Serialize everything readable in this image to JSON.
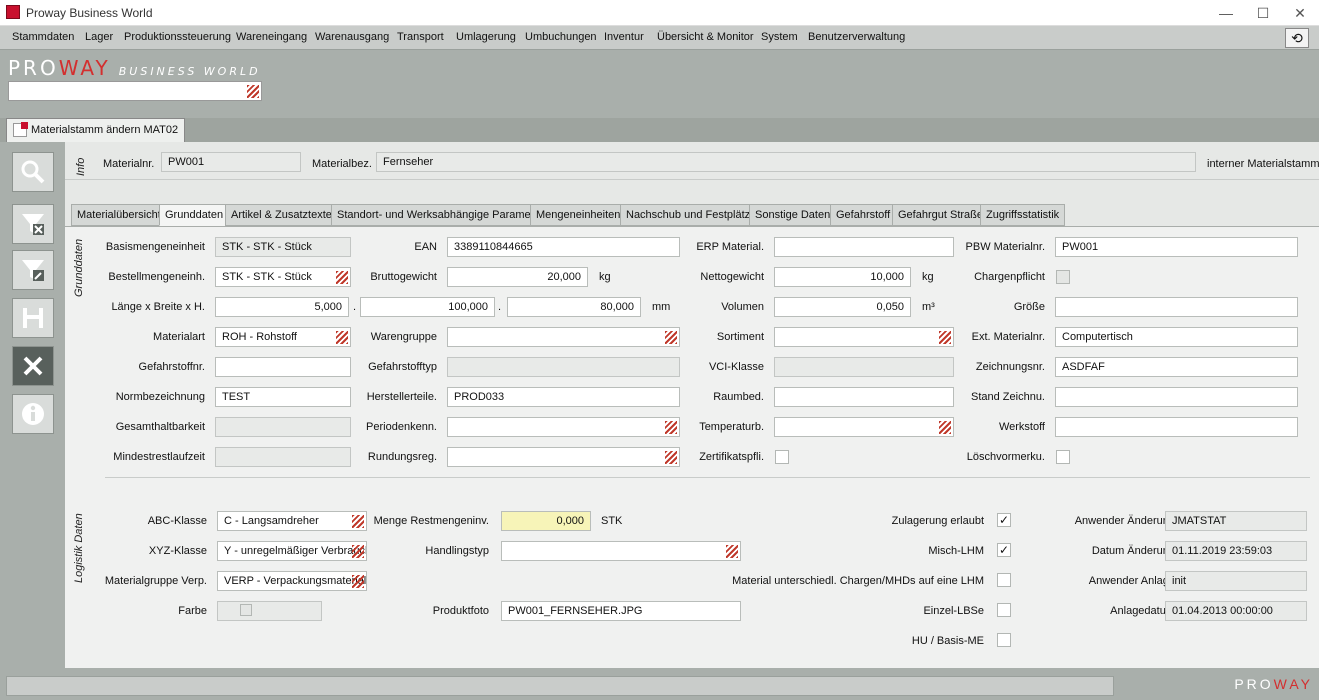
{
  "window": {
    "title": "Proway Business World",
    "minimize": "—",
    "maximize": "☐",
    "close": "✕"
  },
  "menu": [
    "Stammdaten",
    "Lager",
    "Produktionssteuerung",
    "Wareneingang",
    "Warenausgang",
    "Transport",
    "Umlagerung",
    "Umbuchungen",
    "Inventur",
    "Übersicht & Monitor",
    "System",
    "Benutzerverwaltung"
  ],
  "logo": {
    "pro": "PRO",
    "way": "WAY",
    "bw": "BUSINESS WORLD"
  },
  "doc_tab": "Materialstamm ändern MAT02",
  "info": {
    "section": "Info",
    "materialnr_label": "Materialnr.",
    "materialnr": "PW001",
    "materialbez_label": "Materialbez.",
    "materialbez": "Fernseher",
    "note": "interner Materialstamm"
  },
  "subtabs": [
    "Materialübersicht",
    "Grunddaten",
    "Artikel & Zusatztexte",
    "Standort- und Werksabhängige Parameter",
    "Mengeneinheiten",
    "Nachschub und Festplätze",
    "Sonstige Daten",
    "Gefahrstoff",
    "Gefahrgut Straße",
    "Zugriffsstatistik"
  ],
  "grunddaten": {
    "section": "Grunddaten",
    "basismenge_label": "Basismengeneinheit",
    "basismenge": "STK - STK - Stück",
    "bestellmenge_label": "Bestellmengeneinh.",
    "bestellmenge": "STK - STK - Stück",
    "lbh_label": "Länge x Breite x H.",
    "laenge": "5,000",
    "breite": "100,000",
    "hoehe": "80,000",
    "dot": ".",
    "mm": "mm",
    "materialart_label": "Materialart",
    "materialart": "ROH - Rohstoff",
    "gefahrstoffnr_label": "Gefahrstoffnr.",
    "normbez_label": "Normbezeichnung",
    "normbez": "TEST",
    "gesamthalt_label": "Gesamthaltbarkeit",
    "mindestrest_label": "Mindestrestlaufzeit",
    "ean_label": "EAN",
    "ean": "3389110844665",
    "brutto_label": "Bruttogewicht",
    "brutto": "20,000",
    "kg": "kg",
    "warengruppe_label": "Warengruppe",
    "gefahrstofftyp_label": "Gefahrstofftyp",
    "herstellerteile_label": "Herstellerteile.",
    "herstellerteile": "PROD033",
    "periodenkenn_label": "Periodenkenn.",
    "rundungsreg_label": "Rundungsreg.",
    "erp_label": "ERP Material.",
    "netto_label": "Nettogewicht",
    "netto": "10,000",
    "volumen_label": "Volumen",
    "volumen": "0,050",
    "m3": "m³",
    "sortiment_label": "Sortiment",
    "vci_label": "VCI-Klasse",
    "raumbed_label": "Raumbed.",
    "temperatur_label": "Temperaturb.",
    "zertifikat_label": "Zertifikatspfli.",
    "pbw_label": "PBW Materialnr.",
    "pbw": "PW001",
    "chargen_label": "Chargenpflicht",
    "groesse_label": "Größe",
    "extmat_label": "Ext. Materialnr.",
    "extmat": "Computertisch",
    "zeichnung_label": "Zeichnungsnr.",
    "zeichnung": "ASDFAF",
    "standzeich_label": "Stand Zeichnu.",
    "werkstoff_label": "Werkstoff",
    "loesch_label": "Löschvormerku."
  },
  "logistik": {
    "section": "Logistik Daten",
    "abc_label": "ABC-Klasse",
    "abc": "C - Langsamdreher",
    "xyz_label": "XYZ-Klasse",
    "xyz": "Y - unregelmäßiger Verbrauch",
    "matgrp_label": "Materialgruppe Verp.",
    "matgrp": "VERP - Verpackungsmaterial",
    "farbe_label": "Farbe",
    "menge_label": "Menge Restmengeninv.",
    "menge": "0,000",
    "stk": "STK",
    "handling_label": "Handlingstyp",
    "foto_label": "Produktfoto",
    "foto": "PW001_FERNSEHER.JPG",
    "zulagerung_label": "Zulagerung erlaubt",
    "zulagerung": "✓",
    "misch_label": "Misch-LHM",
    "misch": "✓",
    "unterschiedl_label": "Material unterschiedl. Chargen/MHDs auf eine LHM",
    "einzel_label": "Einzel-LBSe",
    "hu_label": "HU / Basis-ME",
    "anw_aend_label": "Anwender Änderung",
    "anw_aend": "JMATSTAT",
    "dat_aend_label": "Datum Änderung",
    "dat_aend": "01.11.2019 23:59:03",
    "anw_anl_label": "Anwender Anlage",
    "anw_anl": "init",
    "anl_dat_label": "Anlagedatum",
    "anl_dat": "01.04.2013 00:00:00"
  },
  "footer": {
    "pro": "PRO",
    "way": "WAY"
  }
}
